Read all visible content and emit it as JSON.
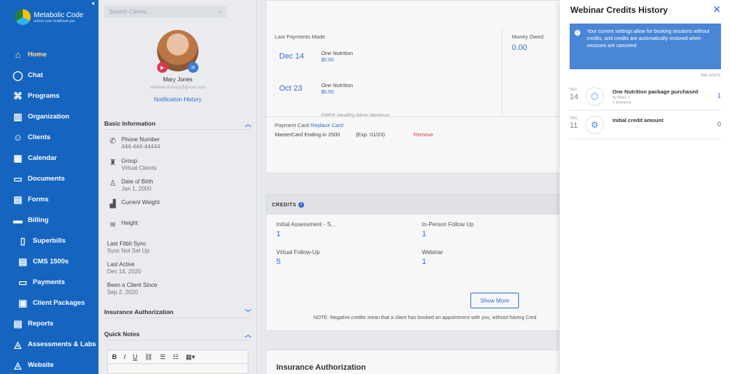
{
  "sidebar": {
    "logo": {
      "name": "Metabolic Code",
      "tagline": "unlock your healthiest you"
    },
    "collapse_icon": "◂",
    "items": [
      {
        "label": "Home",
        "icon": "home-icon",
        "glyph": "⌂",
        "active": true
      },
      {
        "label": "Chat",
        "icon": "chat-icon",
        "glyph": "◯"
      },
      {
        "label": "Programs",
        "icon": "programs-icon",
        "glyph": "⌘"
      },
      {
        "label": "Organization",
        "icon": "organization-icon",
        "glyph": "▥"
      },
      {
        "label": "Clients",
        "icon": "clients-icon",
        "glyph": "☺"
      },
      {
        "label": "Calendar",
        "icon": "calendar-icon",
        "glyph": "▦"
      },
      {
        "label": "Documents",
        "icon": "documents-icon",
        "glyph": "▭"
      },
      {
        "label": "Forms",
        "icon": "forms-icon",
        "glyph": "▤"
      },
      {
        "label": "Billing",
        "icon": "billing-icon",
        "glyph": "▬"
      },
      {
        "label": "Superbills",
        "icon": "superbills-icon",
        "glyph": "▯",
        "sub": true
      },
      {
        "label": "CMS 1500s",
        "icon": "cms-icon",
        "glyph": "▤",
        "sub": true
      },
      {
        "label": "Payments",
        "icon": "payments-icon",
        "glyph": "▭",
        "sub": true
      },
      {
        "label": "Client Packages",
        "icon": "packages-icon",
        "glyph": "▣",
        "sub": true
      },
      {
        "label": "Reports",
        "icon": "reports-icon",
        "glyph": "▤"
      },
      {
        "label": "Assessments & Labs",
        "icon": "assessments-icon",
        "glyph": "◬"
      },
      {
        "label": "Website",
        "icon": "website-icon",
        "glyph": "◬"
      }
    ]
  },
  "client": {
    "search_placeholder": "Search Clients...",
    "name": "Mary Jones",
    "email": "stefanie.turney@gmail.com",
    "notification_link": "Notification History",
    "basic_info_title": "Basic Information",
    "fields": [
      {
        "label": "Phone Number",
        "value": "444-444-44444"
      },
      {
        "label": "Group",
        "value": "Virtual Clients"
      },
      {
        "label": "Date of Birth",
        "value": "Jan 1, 2000"
      },
      {
        "label": "Current Weight",
        "value": ""
      },
      {
        "label": "Height",
        "value": ""
      }
    ],
    "plain_fields": [
      {
        "label": "Last Fitbit Sync",
        "value": "Sync Not Set Up"
      },
      {
        "label": "Last Active",
        "value": "Dec 14, 2020"
      },
      {
        "label": "Been a Client Since",
        "value": "Sep 2, 2020"
      }
    ],
    "insurance_title": "Insurance Authorization",
    "quick_notes_title": "Quick Notes",
    "editor_tools": [
      "B",
      "I",
      "U",
      "⛓",
      "☰",
      "☷",
      "▦▾"
    ]
  },
  "payments": {
    "last_payments_label": "Last Payments Made",
    "money_owed_label": "Money Owed",
    "money_owed_value": "0.00",
    "rows": [
      {
        "date": "Dec 14",
        "name": "One Nutrition",
        "amount": "$0.00"
      },
      {
        "date": "Oct 23",
        "name": "One Nutrition",
        "amount": "$0.00"
      }
    ],
    "faded_row": "FREE Healthy Mom Webinar",
    "payment_card_label": "Payment Card",
    "replace_card": "Replace Card",
    "card_desc": "MasterCard Ending in 2500",
    "card_exp": "(Exp. 01/23)",
    "remove": "Remove"
  },
  "credits": {
    "title": "CREDITS",
    "items": [
      {
        "name": "Initial Assessment - S...",
        "value": "1"
      },
      {
        "name": "In-Person Follow Up",
        "value": "1"
      },
      {
        "name": "Virtual Follow-Up",
        "value": "5"
      },
      {
        "name": "Webinar",
        "value": "1"
      }
    ],
    "show_more": "Show More",
    "note": "NOTE: Negative credits mean that a client has booked an appointment with you, without having Cred"
  },
  "insurance_card_title": "Insurance Authorization",
  "panel": {
    "title": "Webinar Credits History",
    "close": "✕",
    "note": "Your current settings allow for booking sessions without credits, and credits are automatically restored when sessions are canceled.",
    "balance_label": "BALANCE",
    "history": [
      {
        "month": "DEC",
        "day": "14",
        "title": "One Nutrition package purchased",
        "by": "by Mary J",
        "sessions": "1 sessions",
        "balance": "1",
        "icon": "package-icon",
        "glyph": "⬡",
        "color": "#2f6fd1"
      },
      {
        "month": "DEC",
        "day": "11",
        "title": "Initial credit amount",
        "by": "",
        "sessions": "",
        "balance": "0",
        "icon": "settings-icon",
        "glyph": "⚙",
        "color": "#555555"
      }
    ]
  }
}
